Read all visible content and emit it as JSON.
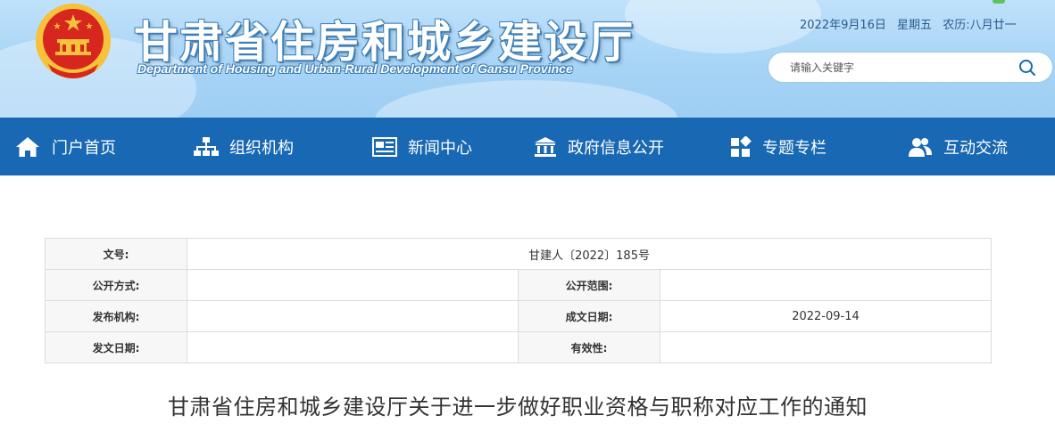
{
  "header": {
    "title": "甘肃省住房和城乡建设厅",
    "subtitle": "Department of Housing and Urban-Rural Development of Gansu Province",
    "date": "2022年9月16日",
    "weekday": "星期五",
    "lunar": "农历:八月廿一",
    "search_placeholder": "请输入关键字"
  },
  "nav": {
    "items": [
      {
        "label": "门户首页",
        "icon": "home-icon"
      },
      {
        "label": "组织机构",
        "icon": "org-chart-icon"
      },
      {
        "label": "新闻中心",
        "icon": "news-icon"
      },
      {
        "label": "政府信息公开",
        "icon": "government-building-icon"
      },
      {
        "label": "专题专栏",
        "icon": "grid-blocks-icon"
      },
      {
        "label": "互动交流",
        "icon": "users-icon"
      }
    ]
  },
  "doc_info": {
    "doc_no_label": "文号:",
    "doc_no_value": "甘建人〔2022〕185号",
    "publish_method_label": "公开方式:",
    "publish_method_value": "",
    "publish_scope_label": "公开范围:",
    "publish_scope_value": "",
    "issuer_label": "发布机构:",
    "issuer_value": "",
    "created_date_label": "成文日期:",
    "created_date_value": "2022-09-14",
    "issue_date_label": "发文日期:",
    "issue_date_value": "",
    "validity_label": "有效性:",
    "validity_value": ""
  },
  "article": {
    "title": "甘肃省住房和城乡建设厅关于进一步做好职业资格与职称对应工作的通知"
  },
  "colors": {
    "nav_bg": "#1868b3",
    "header_sky": "#a7d4f6",
    "emblem_red": "#d7261e",
    "emblem_gold": "#f5c23a"
  }
}
